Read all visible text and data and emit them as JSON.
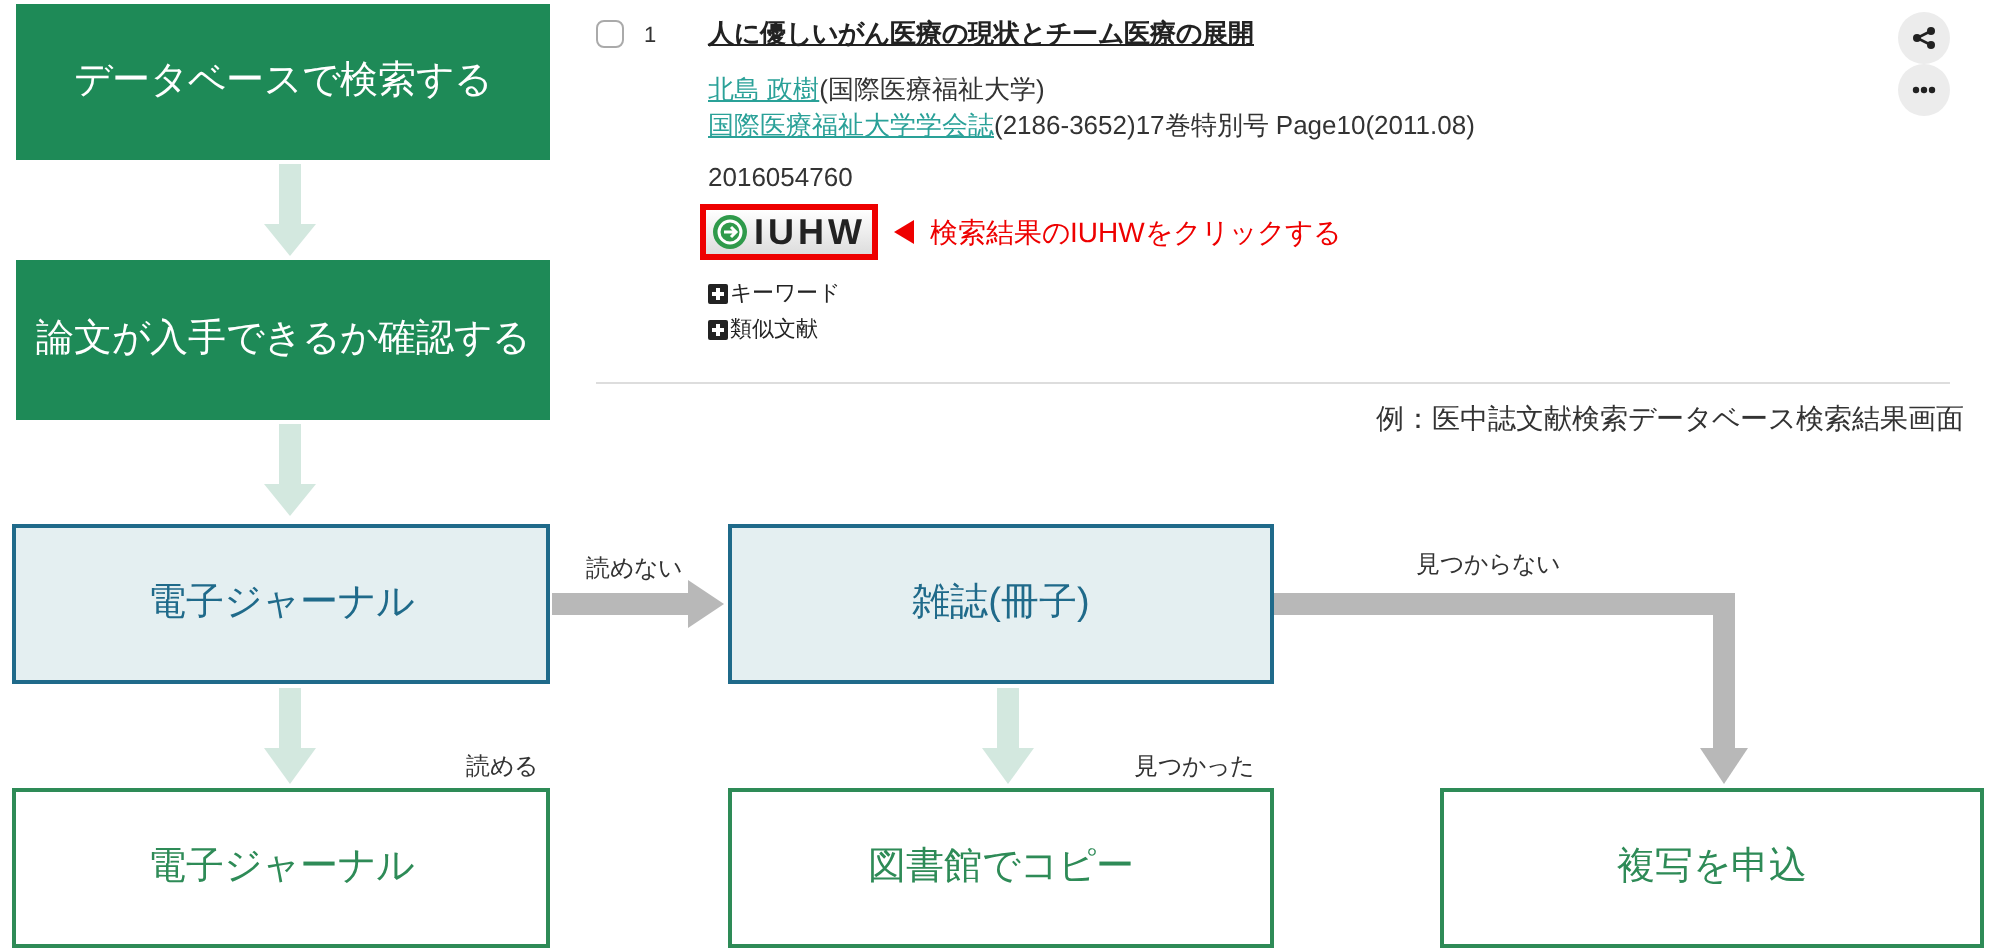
{
  "flow_nodes": [
    {
      "label": "データベースで検索する",
      "kind": "primary"
    },
    {
      "label": "論文が入手できるか確認する",
      "kind": "primary"
    },
    {
      "label": "電子ジャーナル",
      "kind": "decision"
    },
    {
      "label": "雑誌(冊子)",
      "kind": "decision"
    },
    {
      "label": "電子ジャーナル",
      "kind": "outcome"
    },
    {
      "label": "図書館でコピー",
      "kind": "outcome"
    },
    {
      "label": "複写を申込",
      "kind": "outcome"
    }
  ],
  "edge_labels": [
    {
      "label": "読めない",
      "kind": "gray"
    },
    {
      "label": "見つからない",
      "kind": "gray"
    },
    {
      "label": "読める",
      "kind": "light"
    },
    {
      "label": "見つかった",
      "kind": "light"
    }
  ],
  "search_result": {
    "checked": false,
    "index": "1",
    "title": "人に優しいがん医療の現状とチーム医療の展開",
    "author": "北島 政樹",
    "affiliation": "(国際医療福祉大学)",
    "journal": "国際医療福祉大学学会誌",
    "journal_details": "(2186-3652)17巻特別号 Page10(2011.08)",
    "id": "2016054760",
    "fulltext_button": "IUHW",
    "callout": "検索結果のIUHWをクリックする",
    "expand_links": [
      "キーワード",
      "類似文献"
    ]
  },
  "caption": "例：医中誌文献検索データベース検索結果画面"
}
